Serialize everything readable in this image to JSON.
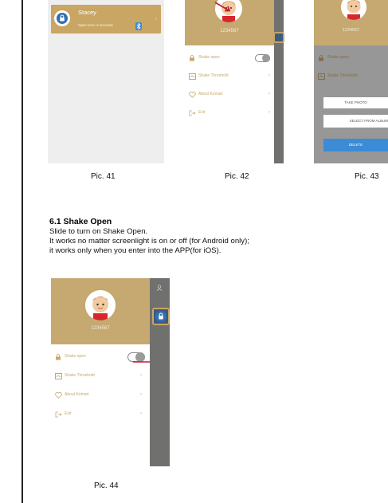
{
  "colors": {
    "gold": "#c5a970",
    "lock_blue": "#2f6fb5",
    "strip": "#70716f",
    "arrow": "#c21e2a",
    "delete_blue": "#3b8bd6"
  },
  "pic41": {
    "lock_name": "Stacey",
    "open_time": "Open time:  5 seconds",
    "caption": "Pic. 41"
  },
  "drawer": {
    "phone": "1234567",
    "menu": [
      {
        "label": "Shake open",
        "icon": "lock-shake-icon"
      },
      {
        "label": "Shake Threshold",
        "icon": "threshold-icon"
      },
      {
        "label": "About Komart",
        "icon": "heart-icon"
      },
      {
        "label": "Exit",
        "icon": "exit-icon"
      }
    ]
  },
  "pic42": {
    "caption": "Pic. 42"
  },
  "pic43": {
    "take_photo": "TAKE PHOTO",
    "select_album": "SELECT FROM ALBUM",
    "delete": "DELETE",
    "caption": "Pic. 43"
  },
  "section": {
    "title": "6.1 Shake Open",
    "lines": [
      "Slide to turn on Shake Open.",
      "It works no matter screenlight is on or off (for Android only);",
      "it works only when you enter into the APP(for iOS)."
    ]
  },
  "pic44": {
    "caption": "Pic. 44"
  }
}
